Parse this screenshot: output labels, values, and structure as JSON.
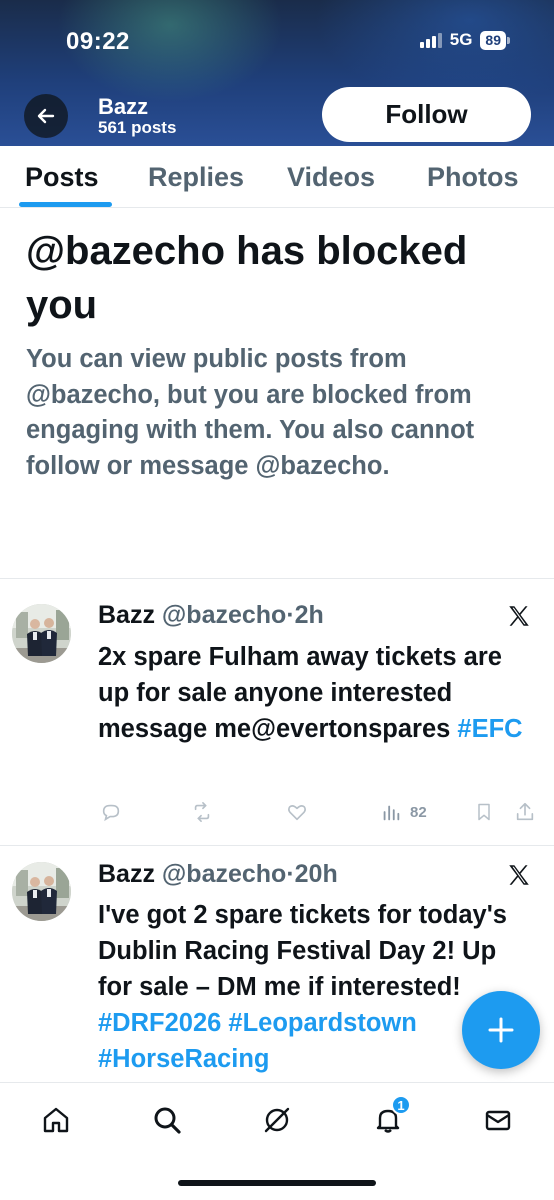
{
  "status_bar": {
    "time": "09:22",
    "network": "5G",
    "battery": "89"
  },
  "header": {
    "name": "Bazz",
    "posts_count": "561 posts",
    "follow_label": "Follow"
  },
  "tabs": [
    {
      "label": "Posts",
      "active": true
    },
    {
      "label": "Replies",
      "active": false
    },
    {
      "label": "Videos",
      "active": false
    },
    {
      "label": "Photos",
      "active": false
    }
  ],
  "blocked": {
    "title": "@bazecho has blocked you",
    "body": "You can view public posts from @bazecho, but you are blocked from engaging with them. You also cannot follow or message @bazecho."
  },
  "tweets": [
    {
      "name": "Bazz",
      "handle": "@bazecho",
      "separator": "·",
      "time": "2h",
      "text": "2x spare Fulham away tickets are up for sale anyone interested message me@evertonspares",
      "hashtags": "#EFC",
      "views": "82"
    },
    {
      "name": "Bazz",
      "handle": "@bazecho",
      "separator": "·",
      "time": "20h",
      "text": "I've got 2 spare tickets for today's Dublin Racing Festival Day 2! Up for sale – DM me if interested!",
      "hashtags": "#DRF2026 #Leopardstown #HorseRacing"
    }
  ],
  "bottom_nav": {
    "items": [
      "home-icon",
      "search-icon",
      "grok-icon",
      "notifications-icon",
      "messages-icon"
    ],
    "notification_count": "1"
  },
  "colors": {
    "accent": "#1d9bf0",
    "text": "#0f1419",
    "secondary": "#536471"
  }
}
